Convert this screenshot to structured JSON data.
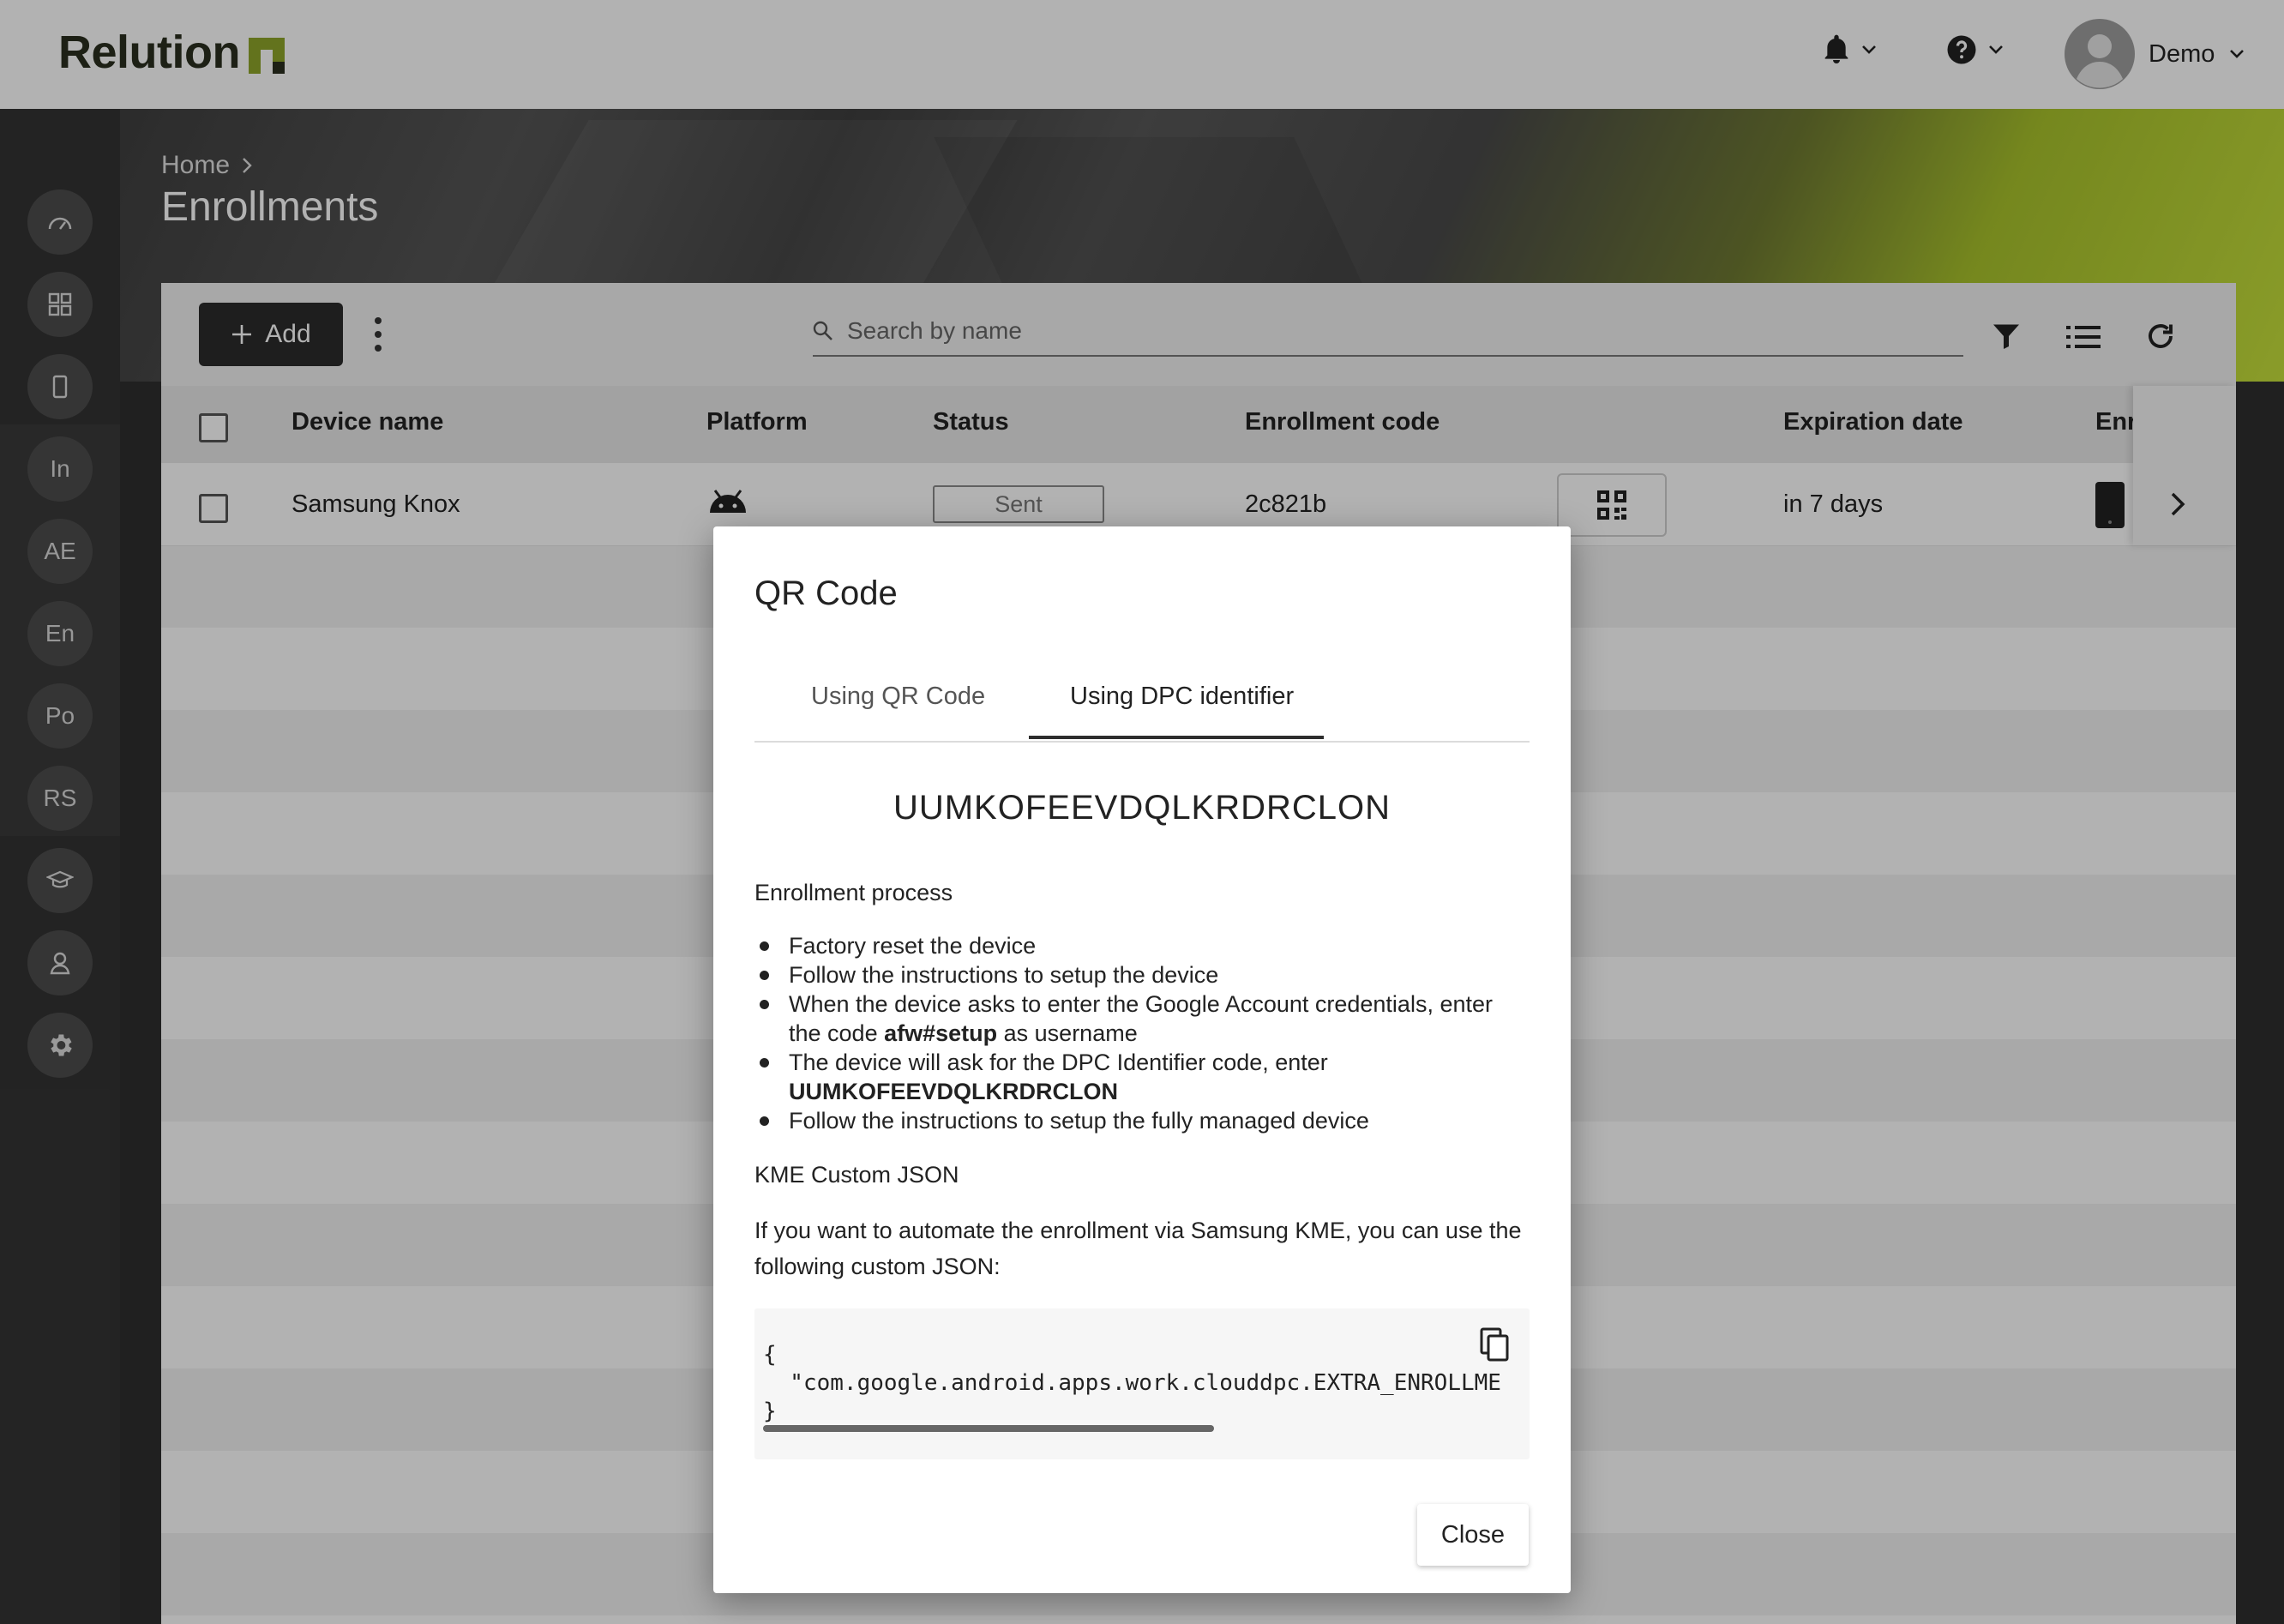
{
  "app": {
    "logo_text": "Relution"
  },
  "topbar": {
    "user_name": "Demo"
  },
  "sidebar": {
    "items": [
      {
        "label": "",
        "icon": "dashboard-icon"
      },
      {
        "label": "",
        "icon": "apps-grid-icon"
      },
      {
        "label": "",
        "icon": "device-icon"
      },
      {
        "label": "In",
        "icon": ""
      },
      {
        "label": "AE",
        "icon": ""
      },
      {
        "label": "En",
        "icon": ""
      },
      {
        "label": "Po",
        "icon": ""
      },
      {
        "label": "RS",
        "icon": ""
      },
      {
        "label": "",
        "icon": "graduation-cap-icon"
      },
      {
        "label": "",
        "icon": "user-icon"
      },
      {
        "label": "",
        "icon": "gear-icon"
      }
    ]
  },
  "header": {
    "breadcrumb": "Home",
    "title": "Enrollments"
  },
  "toolbar": {
    "add_label": "Add",
    "search_placeholder": "Search by name"
  },
  "table": {
    "columns": [
      "Device name",
      "Platform",
      "Status",
      "Enrollment code",
      "Expiration date",
      "Enr"
    ],
    "rows": [
      {
        "device_name": "Samsung Knox",
        "platform": "android-icon",
        "status": "Sent",
        "enrollment_code": "2c821b",
        "expiration": "in 7 days"
      }
    ]
  },
  "modal": {
    "title": "QR Code",
    "tabs": [
      "Using QR Code",
      "Using DPC identifier"
    ],
    "active_tab": 1,
    "dpc_code": "UUMKOFEEVDQLKRDRCLON",
    "process_title": "Enrollment process",
    "steps": {
      "s1": "Factory reset the device",
      "s2": "Follow the instructions to setup the device",
      "s3_pre": "When the device asks to enter the Google Account credentials, enter the code ",
      "s3_bold": "afw#setup",
      "s3_post": " as username",
      "s4_pre": "The device will ask for the DPC Identifier code, enter ",
      "s4_bold": "UUMKOFEEVDQLKRDRCLON",
      "s5": "Follow the instructions to setup the fully managed device"
    },
    "kme_title": "KME Custom JSON",
    "kme_desc": "If you want to automate the enrollment via Samsung KME, you can use the following custom JSON:",
    "code": "{\n  \"com.google.android.apps.work.clouddpc.EXTRA_ENROLLMENT_TOKEN\": \"UUMKOFEEVDQLKRDRCLON\"\n}",
    "close_label": "Close"
  },
  "colors": {
    "brand_green": "#8fa52a",
    "dark_button": "#2b2b2b",
    "sidebar_bg": "#333333"
  }
}
